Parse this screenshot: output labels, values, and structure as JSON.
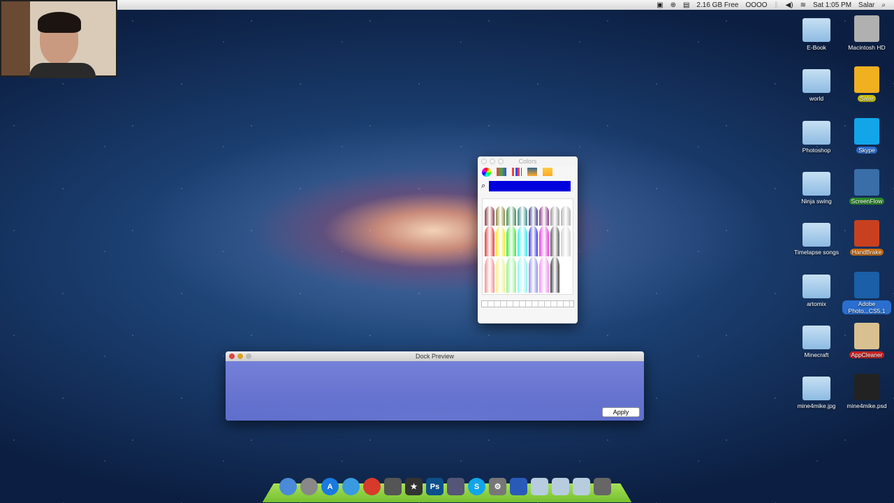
{
  "menubar": {
    "items": [
      "screen-icon",
      "sync-icon",
      "monitor-icon"
    ],
    "disk_free": "2.16 GB Free",
    "indicator": "OOOO",
    "clock": "Sat 1:05 PM",
    "user": "Salar"
  },
  "desktop": {
    "left_column": [
      "E-Book",
      "world",
      "Photoshop",
      "Ninja swing",
      "Timelapse songs",
      "artomix",
      "Minecraft",
      "mine4mike.jpg"
    ],
    "right_column": [
      {
        "label": "Macintosh HD",
        "color": "#b0b0b0",
        "badge": false
      },
      {
        "label": "Salar",
        "color": "#f0b020",
        "badge": true
      },
      {
        "label": "Skype",
        "color": "#12a5e8",
        "badge": true
      },
      {
        "label": "ScreenFlow",
        "color": "#3a6ea8",
        "badge": true
      },
      {
        "label": "HandBrake",
        "color": "#c84020",
        "badge": true
      },
      {
        "label": "Adobe Photo...CS5.1",
        "color": "#1a5fa8",
        "badge": true
      },
      {
        "label": "AppCleaner",
        "color": "#d8c090",
        "badge": true
      },
      {
        "label": "mine4mike.psd",
        "color": "#222",
        "badge": false
      }
    ]
  },
  "colors_window": {
    "title": "Colors",
    "selected_color": "#0000dd",
    "crayons": [
      "#7a1f2a",
      "#7a7a1f",
      "#1f7a3a",
      "#1f7a7a",
      "#1f1f7a",
      "#7a1f7a",
      "#888",
      "#aaa",
      "#e81818",
      "#f0e818",
      "#18e818",
      "#18e8e8",
      "#1818e8",
      "#e818e8",
      "#444",
      "#ccc",
      "#f08080",
      "#f0f080",
      "#80f080",
      "#80f0f0",
      "#8080f0",
      "#f080f0",
      "#222",
      "#fff"
    ]
  },
  "dock_preview": {
    "title": "Dock Preview",
    "apply_label": "Apply"
  },
  "dock": {
    "apps": [
      {
        "name": "finder",
        "color": "#4a8ad8",
        "g": ""
      },
      {
        "name": "launchpad",
        "color": "#888",
        "g": ""
      },
      {
        "name": "app-store",
        "color": "#1a7ae0",
        "g": "A"
      },
      {
        "name": "safari",
        "color": "#3a9ae0",
        "g": ""
      },
      {
        "name": "chrome",
        "color": "#d83a2a",
        "g": ""
      },
      {
        "name": "facetime",
        "color": "#555",
        "g": ""
      },
      {
        "name": "imovie",
        "color": "#333",
        "g": "★"
      },
      {
        "name": "photoshop",
        "color": "#0c4f8a",
        "g": "Ps"
      },
      {
        "name": "screenflow",
        "color": "#557",
        "g": ""
      },
      {
        "name": "skype",
        "color": "#12a5e8",
        "g": "S"
      },
      {
        "name": "system-preferences",
        "color": "#777",
        "g": "⚙"
      },
      {
        "name": "dock-app",
        "color": "#2a5ab8",
        "g": ""
      },
      {
        "name": "downloads-stack",
        "color": "#b8cce0",
        "g": ""
      },
      {
        "name": "documents-stack",
        "color": "#b8cce0",
        "g": ""
      },
      {
        "name": "applications-stack",
        "color": "#b8cce0",
        "g": ""
      },
      {
        "name": "trash",
        "color": "#666",
        "g": ""
      }
    ]
  }
}
